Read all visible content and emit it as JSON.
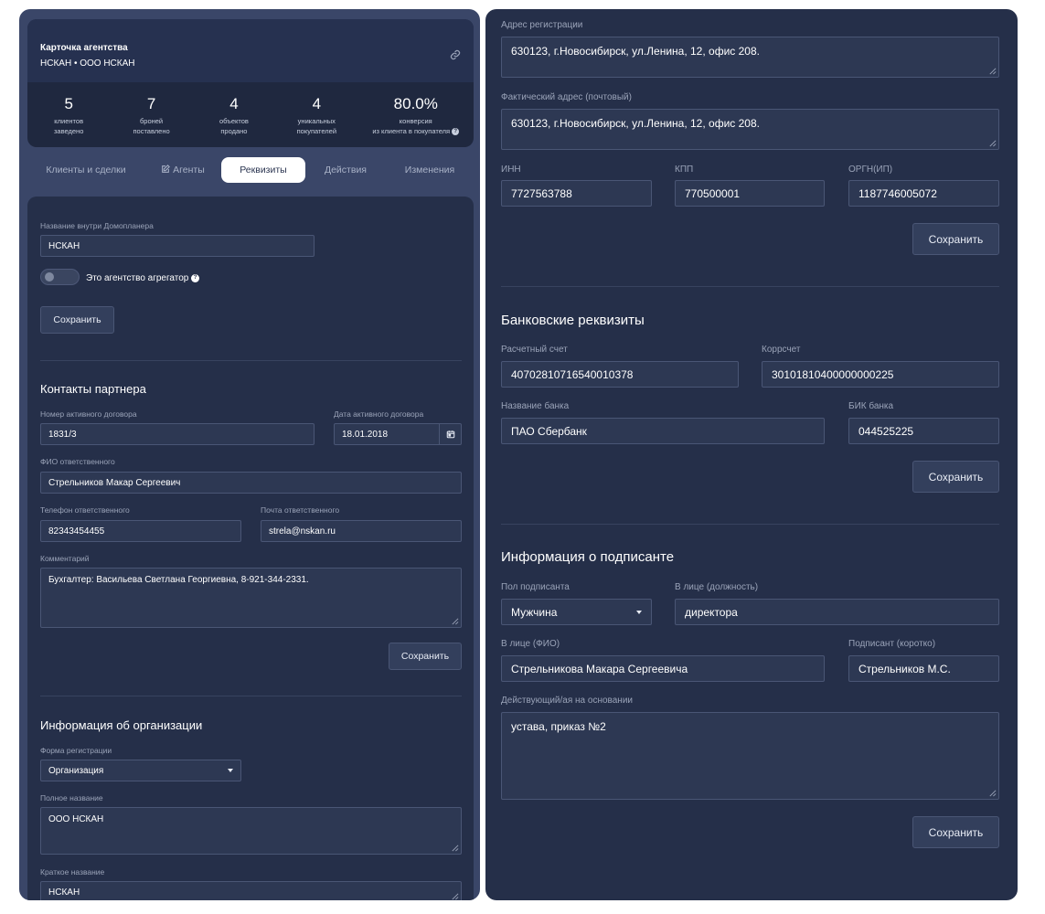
{
  "agency": {
    "title": "Карточка агентства",
    "subtitle": "НСКАН • ООО НСКАН",
    "link_icon": "link-icon"
  },
  "stats": [
    {
      "value": "5",
      "label1": "клиентов",
      "label2": "заведено"
    },
    {
      "value": "7",
      "label1": "броней",
      "label2": "поставлено"
    },
    {
      "value": "4",
      "label1": "объектов",
      "label2": "продано"
    },
    {
      "value": "4",
      "label1": "уникальных",
      "label2": "покупателей"
    },
    {
      "value": "80.0%",
      "label1": "конверсия",
      "label2": "из клиента в покупателя"
    }
  ],
  "tabs": {
    "clients": "Клиенты и сделки",
    "agents": "Агенты",
    "requisites": "Реквизиты",
    "actions": "Действия",
    "changes": "Изменения"
  },
  "general": {
    "name_label": "Название внутри Домопланера",
    "name_value": "НСКАН",
    "aggregator_label": "Это агентство агрегатор",
    "save": "Сохранить"
  },
  "contacts": {
    "title": "Контакты партнера",
    "contract_label": "Номер активного договора",
    "contract_value": "1831/3",
    "date_label": "Дата активного договора",
    "date_value": "18.01.2018",
    "fio_label": "ФИО ответственного",
    "fio_value": "Стрельников Макар Сергеевич",
    "phone_label": "Телефон ответственного",
    "phone_value": "82343454455",
    "email_label": "Почта ответственного",
    "email_value": "strela@nskan.ru",
    "comment_label": "Комментарий",
    "comment_value": "Бухгалтер: Васильева Светлана Георгиевна, 8-921-344-2331.",
    "save": "Сохранить"
  },
  "org": {
    "title": "Информация об организации",
    "form_label": "Форма регистрации",
    "form_value": "Организация",
    "full_label": "Полное название",
    "full_value": "ООО НСКАН",
    "short_label": "Краткое название",
    "short_value": "НСКАН",
    "reg_addr_label": "Адрес регистрации",
    "reg_addr_value": "630123, г.Новосибирск, ул.Ленина, 12, офис 208.",
    "fact_addr_label": "Фактический адрес (почтовый)",
    "fact_addr_value": "630123, г.Новосибирск, ул.Ленина, 12, офис 208.",
    "inn_label": "ИНН",
    "inn_value": "7727563788",
    "kpp_label": "КПП",
    "kpp_value": "770500001",
    "ogrn_label": "ОРГН(ИП)",
    "ogrn_value": "1187746005072",
    "save": "Сохранить"
  },
  "bank": {
    "title": "Банковские реквизиты",
    "account_label": "Расчетный счет",
    "account_value": "40702810716540010378",
    "corr_label": "Коррсчет",
    "corr_value": "30101810400000000225",
    "bank_label": "Название банка",
    "bank_value": "ПАО Сбербанк",
    "bik_label": "БИК банка",
    "bik_value": "044525225",
    "save": "Сохранить"
  },
  "signer": {
    "title": "Информация о подписанте",
    "sex_label": "Пол подписанта",
    "sex_value": "Мужчина",
    "position_label": "В лице (должность)",
    "position_value": "директора",
    "fio_label": "В лице (ФИО)",
    "fio_value": "Стрельникова Макара Сергеевича",
    "short_label": "Подписант (коротко)",
    "short_value": "Стрельников М.С.",
    "basis_label": "Действующий/ая на основании",
    "basis_value": "устава, приказ №2",
    "save": "Сохранить"
  }
}
